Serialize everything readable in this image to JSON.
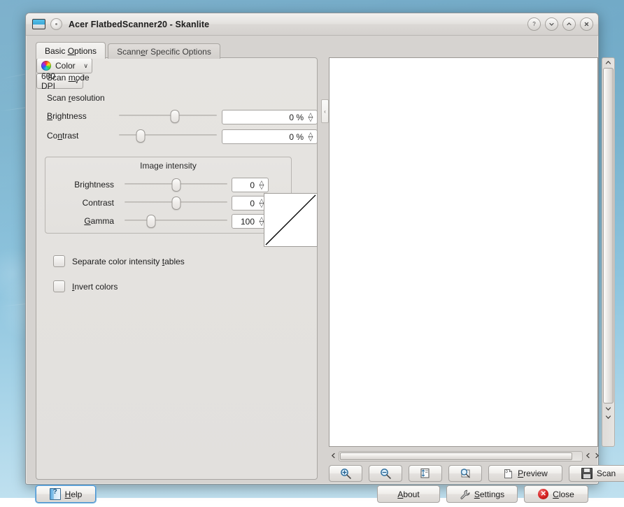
{
  "window": {
    "title": "Acer FlatbedScanner20 - Skanlite",
    "icon_scanner": "scanner-icon",
    "icon_round": "app-icon",
    "buttons": [
      {
        "name": "help-button",
        "glyph": "?"
      },
      {
        "name": "minimize-button",
        "glyph": "v"
      },
      {
        "name": "maximize-button",
        "glyph": "^"
      },
      {
        "name": "close-button",
        "glyph": "x"
      }
    ]
  },
  "tabs": [
    {
      "label": "Basic Options",
      "accel_index": 6,
      "active": true
    },
    {
      "label": "Scanner Specific Options",
      "accel_index": 6,
      "active": false
    }
  ],
  "basic_options": {
    "scan_mode": {
      "label_pre": "Scan ",
      "label_accel": "m",
      "label_post": "ode",
      "value": "Color",
      "icon": "color-wheel-icon",
      "chevron": "∨"
    },
    "scan_resolution": {
      "label_pre": "Scan ",
      "label_accel": "r",
      "label_post": "esolution",
      "value": "600 DPI",
      "chevron": "∨"
    },
    "brightness": {
      "label_accel": "B",
      "label_post": "rightness",
      "slider_percent": 50,
      "value": "0 %"
    },
    "contrast": {
      "label_pre": "Co",
      "label_accel": "n",
      "label_post": "trast",
      "slider_percent": 16,
      "value": "0 %"
    },
    "image_intensity": {
      "title": "Image intensity",
      "rows": [
        {
          "label_pre": "",
          "label_accel": "",
          "label_post": "Brightness",
          "slider_percent": 50,
          "value": "0"
        },
        {
          "label_pre": "",
          "label_accel": "",
          "label_post": "Contrast",
          "slider_percent": 50,
          "value": "0"
        },
        {
          "label_pre": "",
          "label_accel": "G",
          "label_post": "amma",
          "slider_percent": 26,
          "value": "100"
        }
      ],
      "curve": "linear-gamma-curve"
    },
    "checkboxes": [
      {
        "label_pre": "Separate color intensity ",
        "label_accel": "t",
        "label_post": "ables",
        "checked": false
      },
      {
        "label_pre": "",
        "label_accel": "I",
        "label_post": "nvert colors",
        "checked": false
      }
    ]
  },
  "preview": {
    "splitter_glyph": "‹",
    "vscroll": {
      "up_glyph": "∧",
      "down_glyph": "∨",
      "down2_glyph": "∨"
    },
    "hscroll": {
      "left_glyph": "‹",
      "right1_glyph": "‹",
      "right2_glyph": "›"
    }
  },
  "toolbar": [
    {
      "name": "zoom-in-button",
      "icon": "zoom-in-icon",
      "label": ""
    },
    {
      "name": "zoom-out-button",
      "icon": "zoom-out-icon",
      "label": ""
    },
    {
      "name": "zoom-fit-button",
      "icon": "zoom-fit-icon",
      "label": ""
    },
    {
      "name": "zoom-selection-button",
      "icon": "zoom-selection-icon",
      "label": ""
    }
  ],
  "preview_button": {
    "label_pre": "",
    "label_accel": "P",
    "label_post": "review",
    "icon": "document-icon"
  },
  "scan_button": {
    "label": "Scan",
    "icon": "save-floppy-icon"
  },
  "bottom_buttons": {
    "help": {
      "label_pre": "",
      "label_accel": "H",
      "label_post": "elp",
      "icon": "help-book-icon",
      "focused": true
    },
    "about": {
      "label_pre": "",
      "label_accel": "A",
      "label_post": "bout"
    },
    "settings": {
      "label_pre": "",
      "label_accel": "S",
      "label_post": "ettings",
      "icon": "wrench-icon"
    },
    "close": {
      "label_pre": "",
      "label_accel": "C",
      "label_post": "lose",
      "icon": "close-circle-icon"
    }
  },
  "colors": {
    "desktop_top": "#6fa8c6",
    "desktop_bottom": "#bfe0ef",
    "window_bg": "#d6d3d0",
    "panel_bg": "#e6e4e1",
    "accent_focus": "#4c94cf",
    "close_red": "#d52020",
    "preview_white": "#ffffff"
  }
}
